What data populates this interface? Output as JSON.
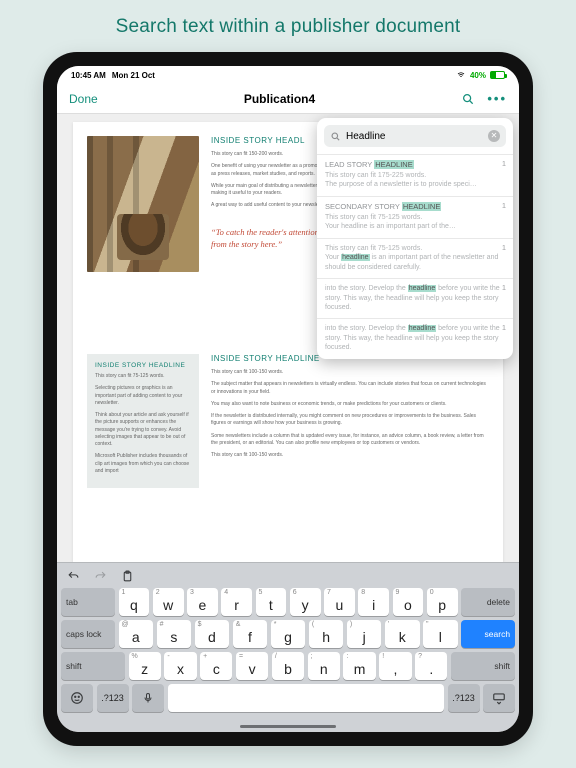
{
  "promo_title": "Search text within a publisher document",
  "status": {
    "time": "10:45 AM",
    "date": "Mon 21 Oct",
    "battery": "40%"
  },
  "nav": {
    "done": "Done",
    "title": "Publication4"
  },
  "search": {
    "query": "Headline"
  },
  "results": [
    {
      "title_pre": "LEAD STORY ",
      "title_hl": "HEADLINE",
      "body": "This story can fit 175-225 words.\nThe purpose of a newsletter is to provide speci…",
      "page": "1"
    },
    {
      "title_pre": "SECONDARY STORY ",
      "title_hl": "HEADLINE",
      "body": "This story can fit 75-125 words.\nYour headline is an important part of the…",
      "page": "1"
    },
    {
      "title_pre": "",
      "title_hl": "",
      "body_pre": "This story can fit 75-125 words.\nYour ",
      "body_hl": "headline",
      "body_post": " is an important part of the newsletter and should be considered carefully.",
      "page": "1"
    },
    {
      "title_pre": "",
      "title_hl": "",
      "body_pre": "into the story. Develop the ",
      "body_hl": "headline",
      "body_post": " before you write the story. This way, the headline will help you keep the story focused.",
      "page": "1"
    },
    {
      "title_pre": "",
      "title_hl": "",
      "body_pre": "into the story. Develop the ",
      "body_hl": "headline",
      "body_post": " before you write the story. This way, the headline will help you keep the story focused.",
      "page": "1"
    }
  ],
  "doc": {
    "h1": "INSIDE STORY HEADL",
    "p1": "This story can fit 150-200 words.",
    "p2": "One benefit of using your newsletter as a promotional tool is that you can reuse content from other marketing materials, such as press releases, market studies, and reports.",
    "p3": "While your main goal of distributing a newsletter might be to sell your product or service, the key to a successful newsletter is making it useful to your readers.",
    "p4": "A great way to add useful content to your newsletter is to develop and",
    "quote": "“To catch the reader's attention, place an inter\nfrom the story here.”",
    "side_h": "INSIDE STORY HEADLINE",
    "side_p1": "This story can fit 75-125 words.",
    "side_p2": "Selecting pictures or graphics is an important part of adding content to your newsletter.",
    "side_p3": "Think about your article and ask yourself if the picture supports or enhances the message you're trying to convey. Avoid selecting images that appear to be out of context.",
    "side_p4": "Microsoft Publisher includes thousands of clip art images from which you can choose and import",
    "mid_h": "INSIDE STORY HEADLINE",
    "mid_p1": "This story can fit 100-150 words.",
    "mid_p2": "The subject matter that appears in newsletters is virtually endless. You can include stories that focus on current technologies or innovations in your field.",
    "mid_p3": "You may also want to note business or economic trends, or make predictions for your customers or clients.",
    "mid_p4": "If the newsletter is distributed internally, you might comment on new procedures or improvements to the business. Sales figures or earnings will show how your business is growing.",
    "mid_p5": "Some newsletters include a column that is updated every issue, for instance, an advice column, a book review, a letter from the president, or an editorial. You can also profile new employees or top customers or vendors.",
    "mid_p6": "This story can fit 100-150 words."
  },
  "kb": {
    "row1": [
      "q",
      "w",
      "e",
      "r",
      "t",
      "y",
      "u",
      "i",
      "o",
      "p"
    ],
    "sub1": [
      "1",
      "2",
      "3",
      "4",
      "5",
      "6",
      "7",
      "8",
      "9",
      "0"
    ],
    "row2": [
      "a",
      "s",
      "d",
      "f",
      "g",
      "h",
      "j",
      "k",
      "l"
    ],
    "sub2": [
      "@",
      "#",
      "$",
      "&",
      "*",
      "(",
      ")",
      "'",
      "\""
    ],
    "row3": [
      "z",
      "x",
      "c",
      "v",
      "b",
      "n",
      "m",
      ",",
      "."
    ],
    "sub3": [
      "%",
      "-",
      "+",
      "=",
      "/",
      ";",
      ":",
      "!",
      "?"
    ],
    "tab": "tab",
    "delete": "delete",
    "caps": "caps lock",
    "search": "search",
    "shift": "shift",
    "num": ".?123"
  }
}
